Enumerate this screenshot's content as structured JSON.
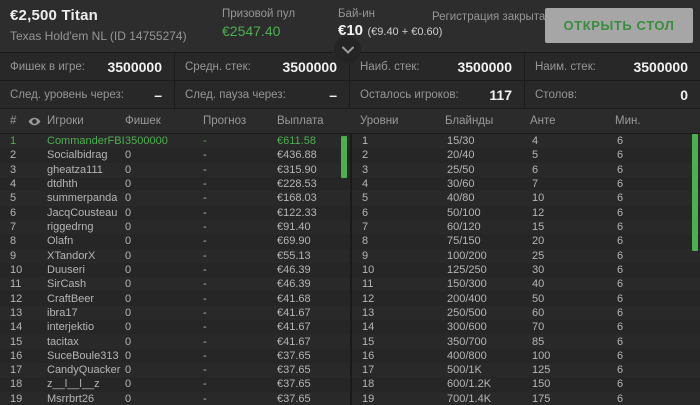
{
  "header": {
    "title": "€2,500 Titan",
    "subtitle": "Texas Hold'em NL (ID 14755274)",
    "prize_pool_label": "Призовой пул",
    "prize_pool_value": "€2547.40",
    "buyin_label": "Бай-ин",
    "buyin_value": "€10",
    "buyin_breakdown": "(€9.40 + €0.60)",
    "registration_status": "Регистрация закрыта",
    "open_table_button": "ОТКРЫТЬ СТОЛ"
  },
  "stats": {
    "row1": [
      {
        "label": "Фишек в игре:",
        "value": "3500000"
      },
      {
        "label": "Средн. стек:",
        "value": "3500000"
      },
      {
        "label": "Наиб. стек:",
        "value": "3500000"
      },
      {
        "label": "Наим. стек:",
        "value": "3500000"
      }
    ],
    "row2": [
      {
        "label": "След. уровень через:",
        "value": "–"
      },
      {
        "label": "След. пауза через:",
        "value": "–"
      },
      {
        "label": "Осталось игроков:",
        "value": "117"
      },
      {
        "label": "Столов:",
        "value": "0"
      }
    ]
  },
  "players_table": {
    "headers": {
      "rank": "#",
      "players": "Игроки",
      "chips": "Фишек",
      "forecast": "Прогноз",
      "payout": "Выплата"
    },
    "rows": [
      {
        "rank": "1",
        "name": "CommanderFBI",
        "chips": "3500000",
        "forecast": "-",
        "payout": "€611.58",
        "highlight": true
      },
      {
        "rank": "2",
        "name": "Socialbidrag",
        "chips": "0",
        "forecast": "-",
        "payout": "€436.88"
      },
      {
        "rank": "3",
        "name": "gheatza111",
        "chips": "0",
        "forecast": "-",
        "payout": "€315.90"
      },
      {
        "rank": "4",
        "name": "dtdhth",
        "chips": "0",
        "forecast": "-",
        "payout": "€228.53"
      },
      {
        "rank": "5",
        "name": "summerpanda",
        "chips": "0",
        "forecast": "-",
        "payout": "€168.03"
      },
      {
        "rank": "6",
        "name": "JacqCousteau",
        "chips": "0",
        "forecast": "-",
        "payout": "€122.33"
      },
      {
        "rank": "7",
        "name": "riggedrng",
        "chips": "0",
        "forecast": "-",
        "payout": "€91.40"
      },
      {
        "rank": "8",
        "name": "Olafn",
        "chips": "0",
        "forecast": "-",
        "payout": "€69.90"
      },
      {
        "rank": "9",
        "name": "XTandorX",
        "chips": "0",
        "forecast": "-",
        "payout": "€55.13"
      },
      {
        "rank": "10",
        "name": "Duuseri",
        "chips": "0",
        "forecast": "-",
        "payout": "€46.39"
      },
      {
        "rank": "11",
        "name": "SirCash",
        "chips": "0",
        "forecast": "-",
        "payout": "€46.39"
      },
      {
        "rank": "12",
        "name": "CraftBeer",
        "chips": "0",
        "forecast": "-",
        "payout": "€41.68"
      },
      {
        "rank": "13",
        "name": "ibra17",
        "chips": "0",
        "forecast": "-",
        "payout": "€41.67"
      },
      {
        "rank": "14",
        "name": "interjektio",
        "chips": "0",
        "forecast": "-",
        "payout": "€41.67"
      },
      {
        "rank": "15",
        "name": "tacitax",
        "chips": "0",
        "forecast": "-",
        "payout": "€41.67"
      },
      {
        "rank": "16",
        "name": "SuceBoule313",
        "chips": "0",
        "forecast": "-",
        "payout": "€37.65"
      },
      {
        "rank": "17",
        "name": "CandyQuacker",
        "chips": "0",
        "forecast": "-",
        "payout": "€37.65"
      },
      {
        "rank": "18",
        "name": "z__l__l__z",
        "chips": "0",
        "forecast": "-",
        "payout": "€37.65"
      },
      {
        "rank": "19",
        "name": "Msrrbrt26",
        "chips": "0",
        "forecast": "-",
        "payout": "€37.65"
      }
    ]
  },
  "levels_table": {
    "headers": {
      "level": "Уровни",
      "blinds": "Блайнды",
      "ante": "Анте",
      "min": "Мин."
    },
    "rows": [
      {
        "level": "1",
        "blinds": "15/30",
        "ante": "4",
        "min": "6"
      },
      {
        "level": "2",
        "blinds": "20/40",
        "ante": "5",
        "min": "6"
      },
      {
        "level": "3",
        "blinds": "25/50",
        "ante": "6",
        "min": "6"
      },
      {
        "level": "4",
        "blinds": "30/60",
        "ante": "7",
        "min": "6"
      },
      {
        "level": "5",
        "blinds": "40/80",
        "ante": "10",
        "min": "6"
      },
      {
        "level": "6",
        "blinds": "50/100",
        "ante": "12",
        "min": "6"
      },
      {
        "level": "7",
        "blinds": "60/120",
        "ante": "15",
        "min": "6"
      },
      {
        "level": "8",
        "blinds": "75/150",
        "ante": "20",
        "min": "6"
      },
      {
        "level": "9",
        "blinds": "100/200",
        "ante": "25",
        "min": "6"
      },
      {
        "level": "10",
        "blinds": "125/250",
        "ante": "30",
        "min": "6"
      },
      {
        "level": "11",
        "blinds": "150/300",
        "ante": "40",
        "min": "6"
      },
      {
        "level": "12",
        "blinds": "200/400",
        "ante": "50",
        "min": "6"
      },
      {
        "level": "13",
        "blinds": "250/500",
        "ante": "60",
        "min": "6"
      },
      {
        "level": "14",
        "blinds": "300/600",
        "ante": "70",
        "min": "6"
      },
      {
        "level": "15",
        "blinds": "350/700",
        "ante": "85",
        "min": "6"
      },
      {
        "level": "16",
        "blinds": "400/800",
        "ante": "100",
        "min": "6"
      },
      {
        "level": "17",
        "blinds": "500/1K",
        "ante": "125",
        "min": "6"
      },
      {
        "level": "18",
        "blinds": "600/1.2K",
        "ante": "150",
        "min": "6"
      },
      {
        "level": "19",
        "blinds": "700/1.4K",
        "ante": "175",
        "min": "6"
      }
    ]
  },
  "colors": {
    "accent_green": "#4caf50",
    "button_bg": "#a6a6a6",
    "button_text": "#388e3c",
    "header_bg": "#2d2d2d"
  },
  "icons": {
    "visibility": "eye-icon",
    "collapse": "chevron-down-icon"
  }
}
